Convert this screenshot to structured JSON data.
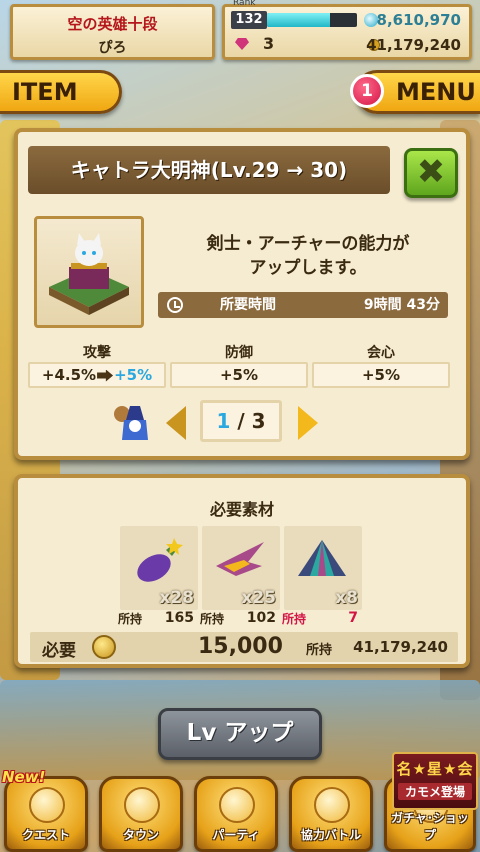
{
  "status": {
    "title": "空の英雄十段",
    "player_name": "ぴろ",
    "rank_label": "Rank",
    "rank": "132",
    "exp_fraction": 0.7,
    "stones": "8,610,970",
    "gems": "3",
    "gold": "41,179,240"
  },
  "buttons": {
    "item": "ITEM",
    "menu": "MENU",
    "menu_badge": "1",
    "close": "✖",
    "lvup": "Lv アップ"
  },
  "upgrade": {
    "title": "キャトラ大明神(Lv.29 → 30)",
    "description": "剣士・アーチャーの能力が\nアップします。",
    "time_label": "所要時間",
    "time_value": "9時間 43分",
    "stats": [
      {
        "name": "攻撃",
        "current": "+4.5%",
        "next": "+5%"
      },
      {
        "name": "防御",
        "value": "+5%"
      },
      {
        "name": "会心",
        "value": "+5%"
      }
    ],
    "page_current": "1",
    "page_sep": "/",
    "page_total": "3"
  },
  "materials": {
    "title": "必要素材",
    "items": [
      {
        "icon": "eggplant-icon",
        "qty": "x28",
        "owned_label": "所持",
        "owned": "165",
        "short": false
      },
      {
        "icon": "swallow-icon",
        "qty": "x25",
        "owned_label": "所持",
        "owned": "102",
        "short": false
      },
      {
        "icon": "tent-icon",
        "qty": "x8",
        "owned_label": "所持",
        "owned": "7",
        "short": true
      }
    ],
    "required_label": "必要",
    "cost": "15,000",
    "owned_label": "所持",
    "owned_gold": "41,179,240"
  },
  "nav": {
    "new_badge": "New!",
    "items": [
      {
        "label": "クエスト",
        "icon": "quest-icon"
      },
      {
        "label": "タウン",
        "icon": "town-icon"
      },
      {
        "label": "パーティ",
        "icon": "party-icon"
      },
      {
        "label": "協力バトル",
        "icon": "coop-battle-icon"
      },
      {
        "label": "ガチャ･ショップ",
        "icon": "gacha-icon"
      }
    ],
    "event_line1": "名★星★会",
    "event_line2": "カモメ登場"
  },
  "colors": {
    "panel_bg": "#f6ecd2",
    "panel_border": "#b98d3e",
    "accent_blue": "#2ba8e0",
    "shortage_red": "#d31446",
    "button_gold": "#f0a712"
  }
}
